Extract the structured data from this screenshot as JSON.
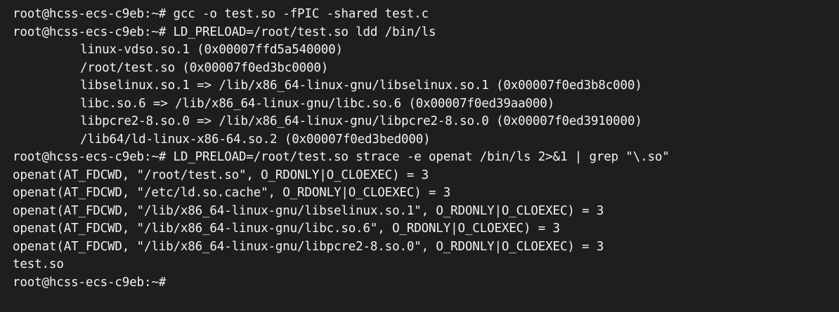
{
  "terminal": {
    "prompt": "root@hcss-ecs-c9eb:~#",
    "lines": [
      {
        "text": "root@hcss-ecs-c9eb:~# gcc -o test.so -fPIC -shared test.c",
        "indented": false
      },
      {
        "text": "root@hcss-ecs-c9eb:~# LD_PRELOAD=/root/test.so ldd /bin/ls",
        "indented": false
      },
      {
        "text": "linux-vdso.so.1 (0x00007ffd5a540000)",
        "indented": true
      },
      {
        "text": "/root/test.so (0x00007f0ed3bc0000)",
        "indented": true
      },
      {
        "text": "libselinux.so.1 => /lib/x86_64-linux-gnu/libselinux.so.1 (0x00007f0ed3b8c000)",
        "indented": true
      },
      {
        "text": "libc.so.6 => /lib/x86_64-linux-gnu/libc.so.6 (0x00007f0ed39aa000)",
        "indented": true
      },
      {
        "text": "libpcre2-8.so.0 => /lib/x86_64-linux-gnu/libpcre2-8.so.0 (0x00007f0ed3910000)",
        "indented": true
      },
      {
        "text": "/lib64/ld-linux-x86-64.so.2 (0x00007f0ed3bed000)",
        "indented": true
      },
      {
        "text": "root@hcss-ecs-c9eb:~# LD_PRELOAD=/root/test.so strace -e openat /bin/ls 2>&1 | grep \"\\.so\"",
        "indented": false
      },
      {
        "text": "openat(AT_FDCWD, \"/root/test.so\", O_RDONLY|O_CLOEXEC) = 3",
        "indented": false
      },
      {
        "text": "openat(AT_FDCWD, \"/etc/ld.so.cache\", O_RDONLY|O_CLOEXEC) = 3",
        "indented": false
      },
      {
        "text": "openat(AT_FDCWD, \"/lib/x86_64-linux-gnu/libselinux.so.1\", O_RDONLY|O_CLOEXEC) = 3",
        "indented": false
      },
      {
        "text": "openat(AT_FDCWD, \"/lib/x86_64-linux-gnu/libc.so.6\", O_RDONLY|O_CLOEXEC) = 3",
        "indented": false
      },
      {
        "text": "openat(AT_FDCWD, \"/lib/x86_64-linux-gnu/libpcre2-8.so.0\", O_RDONLY|O_CLOEXEC) = 3",
        "indented": false
      },
      {
        "text": "test.so",
        "indented": false
      }
    ],
    "colors": {
      "background": "#1e1e20",
      "foreground": "#f2f2f2"
    }
  }
}
